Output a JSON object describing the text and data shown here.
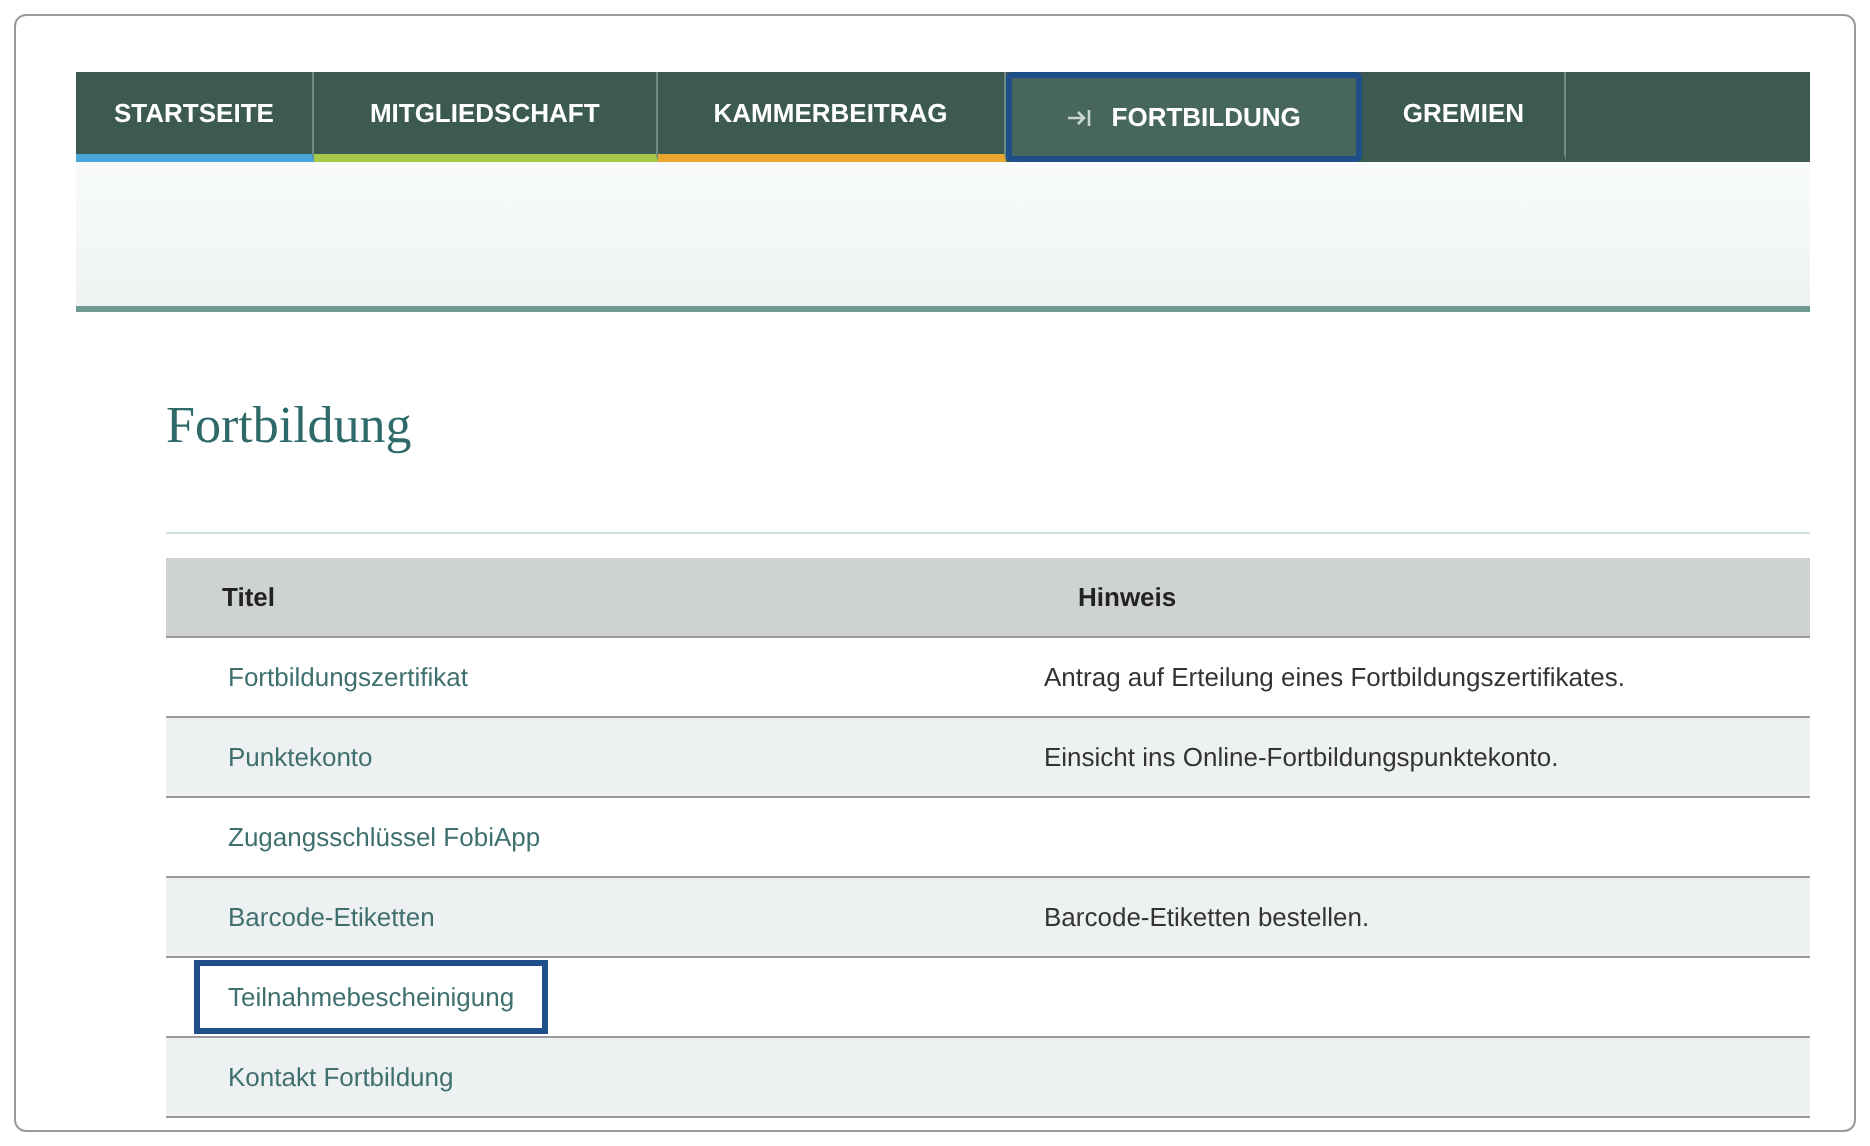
{
  "nav": {
    "tabs": [
      {
        "label": "STARTSEITE",
        "color": "#4aa8d8",
        "selected": false,
        "highlighted": false
      },
      {
        "label": "MITGLIEDSCHAFT",
        "color": "#a8c84a",
        "selected": false,
        "highlighted": false
      },
      {
        "label": "KAMMERBEITRAG",
        "color": "#e8a830",
        "selected": false,
        "highlighted": false
      },
      {
        "label": "FORTBILDUNG",
        "selected": true,
        "highlighted": true
      },
      {
        "label": "GREMIEN",
        "selected": false,
        "highlighted": false
      }
    ]
  },
  "heading": "Fortbildung",
  "table": {
    "columns": [
      "Titel",
      "Hinweis"
    ],
    "rows": [
      {
        "title": "Fortbildungszertifikat",
        "note": "Antrag auf Erteilung eines Fortbildungszertifikates.",
        "highlighted": false
      },
      {
        "title": "Punktekonto",
        "note": "Einsicht ins Online-Fortbildungspunktekonto.",
        "highlighted": false
      },
      {
        "title": "Zugangsschlüssel FobiApp",
        "highlighted": false
      },
      {
        "title": "Barcode-Etiketten",
        "note": "Barcode-Etiketten bestellen.",
        "highlighted": false
      },
      {
        "title": "Teilnahmebescheinigung",
        "highlighted": true
      },
      {
        "title": "Kontakt Fortbildung",
        "highlighted": false
      }
    ]
  }
}
